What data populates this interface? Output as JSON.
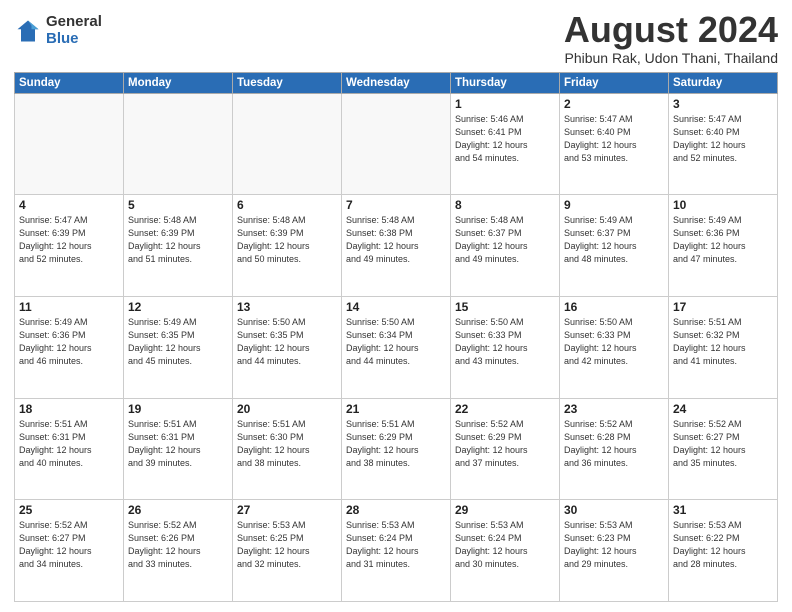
{
  "header": {
    "logo_general": "General",
    "logo_blue": "Blue",
    "month_title": "August 2024",
    "subtitle": "Phibun Rak, Udon Thani, Thailand"
  },
  "weekdays": [
    "Sunday",
    "Monday",
    "Tuesday",
    "Wednesday",
    "Thursday",
    "Friday",
    "Saturday"
  ],
  "weeks": [
    [
      {
        "day": "",
        "info": ""
      },
      {
        "day": "",
        "info": ""
      },
      {
        "day": "",
        "info": ""
      },
      {
        "day": "",
        "info": ""
      },
      {
        "day": "1",
        "info": "Sunrise: 5:46 AM\nSunset: 6:41 PM\nDaylight: 12 hours\nand 54 minutes."
      },
      {
        "day": "2",
        "info": "Sunrise: 5:47 AM\nSunset: 6:40 PM\nDaylight: 12 hours\nand 53 minutes."
      },
      {
        "day": "3",
        "info": "Sunrise: 5:47 AM\nSunset: 6:40 PM\nDaylight: 12 hours\nand 52 minutes."
      }
    ],
    [
      {
        "day": "4",
        "info": "Sunrise: 5:47 AM\nSunset: 6:39 PM\nDaylight: 12 hours\nand 52 minutes."
      },
      {
        "day": "5",
        "info": "Sunrise: 5:48 AM\nSunset: 6:39 PM\nDaylight: 12 hours\nand 51 minutes."
      },
      {
        "day": "6",
        "info": "Sunrise: 5:48 AM\nSunset: 6:39 PM\nDaylight: 12 hours\nand 50 minutes."
      },
      {
        "day": "7",
        "info": "Sunrise: 5:48 AM\nSunset: 6:38 PM\nDaylight: 12 hours\nand 49 minutes."
      },
      {
        "day": "8",
        "info": "Sunrise: 5:48 AM\nSunset: 6:37 PM\nDaylight: 12 hours\nand 49 minutes."
      },
      {
        "day": "9",
        "info": "Sunrise: 5:49 AM\nSunset: 6:37 PM\nDaylight: 12 hours\nand 48 minutes."
      },
      {
        "day": "10",
        "info": "Sunrise: 5:49 AM\nSunset: 6:36 PM\nDaylight: 12 hours\nand 47 minutes."
      }
    ],
    [
      {
        "day": "11",
        "info": "Sunrise: 5:49 AM\nSunset: 6:36 PM\nDaylight: 12 hours\nand 46 minutes."
      },
      {
        "day": "12",
        "info": "Sunrise: 5:49 AM\nSunset: 6:35 PM\nDaylight: 12 hours\nand 45 minutes."
      },
      {
        "day": "13",
        "info": "Sunrise: 5:50 AM\nSunset: 6:35 PM\nDaylight: 12 hours\nand 44 minutes."
      },
      {
        "day": "14",
        "info": "Sunrise: 5:50 AM\nSunset: 6:34 PM\nDaylight: 12 hours\nand 44 minutes."
      },
      {
        "day": "15",
        "info": "Sunrise: 5:50 AM\nSunset: 6:33 PM\nDaylight: 12 hours\nand 43 minutes."
      },
      {
        "day": "16",
        "info": "Sunrise: 5:50 AM\nSunset: 6:33 PM\nDaylight: 12 hours\nand 42 minutes."
      },
      {
        "day": "17",
        "info": "Sunrise: 5:51 AM\nSunset: 6:32 PM\nDaylight: 12 hours\nand 41 minutes."
      }
    ],
    [
      {
        "day": "18",
        "info": "Sunrise: 5:51 AM\nSunset: 6:31 PM\nDaylight: 12 hours\nand 40 minutes."
      },
      {
        "day": "19",
        "info": "Sunrise: 5:51 AM\nSunset: 6:31 PM\nDaylight: 12 hours\nand 39 minutes."
      },
      {
        "day": "20",
        "info": "Sunrise: 5:51 AM\nSunset: 6:30 PM\nDaylight: 12 hours\nand 38 minutes."
      },
      {
        "day": "21",
        "info": "Sunrise: 5:51 AM\nSunset: 6:29 PM\nDaylight: 12 hours\nand 38 minutes."
      },
      {
        "day": "22",
        "info": "Sunrise: 5:52 AM\nSunset: 6:29 PM\nDaylight: 12 hours\nand 37 minutes."
      },
      {
        "day": "23",
        "info": "Sunrise: 5:52 AM\nSunset: 6:28 PM\nDaylight: 12 hours\nand 36 minutes."
      },
      {
        "day": "24",
        "info": "Sunrise: 5:52 AM\nSunset: 6:27 PM\nDaylight: 12 hours\nand 35 minutes."
      }
    ],
    [
      {
        "day": "25",
        "info": "Sunrise: 5:52 AM\nSunset: 6:27 PM\nDaylight: 12 hours\nand 34 minutes."
      },
      {
        "day": "26",
        "info": "Sunrise: 5:52 AM\nSunset: 6:26 PM\nDaylight: 12 hours\nand 33 minutes."
      },
      {
        "day": "27",
        "info": "Sunrise: 5:53 AM\nSunset: 6:25 PM\nDaylight: 12 hours\nand 32 minutes."
      },
      {
        "day": "28",
        "info": "Sunrise: 5:53 AM\nSunset: 6:24 PM\nDaylight: 12 hours\nand 31 minutes."
      },
      {
        "day": "29",
        "info": "Sunrise: 5:53 AM\nSunset: 6:24 PM\nDaylight: 12 hours\nand 30 minutes."
      },
      {
        "day": "30",
        "info": "Sunrise: 5:53 AM\nSunset: 6:23 PM\nDaylight: 12 hours\nand 29 minutes."
      },
      {
        "day": "31",
        "info": "Sunrise: 5:53 AM\nSunset: 6:22 PM\nDaylight: 12 hours\nand 28 minutes."
      }
    ]
  ]
}
